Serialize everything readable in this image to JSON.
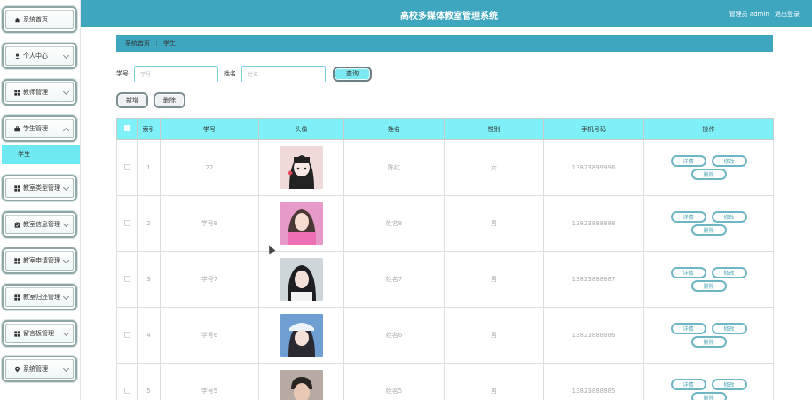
{
  "header": {
    "title": "高校多媒体教室管理系统",
    "user_label": "管理员 admin",
    "logout": "退出登录"
  },
  "sidebar": {
    "items": [
      {
        "label": "系统首页",
        "icon": "home-icon"
      },
      {
        "label": "个人中心",
        "icon": "user-icon"
      },
      {
        "label": "教师管理",
        "icon": "grid-icon"
      },
      {
        "label": "学生管理",
        "icon": "briefcase-icon"
      },
      {
        "label": "教室类型管理",
        "icon": "grid-icon"
      },
      {
        "label": "教室信息管理",
        "icon": "clipboard-icon"
      },
      {
        "label": "教室申请管理",
        "icon": "grid-icon"
      },
      {
        "label": "教室归还管理",
        "icon": "grid-icon"
      },
      {
        "label": "留言板管理",
        "icon": "grid-icon"
      },
      {
        "label": "系统管理",
        "icon": "location-icon"
      }
    ],
    "active_sub": "学生"
  },
  "breadcrumb": {
    "home": "系统首页",
    "sep": "⋮",
    "current": "学生"
  },
  "search": {
    "label_id": "学号",
    "placeholder_id": "学号",
    "label_name": "姓名",
    "placeholder_name": "姓名",
    "query_btn": "查询"
  },
  "actions": {
    "add": "新增",
    "delete": "删除"
  },
  "table": {
    "headers": [
      "",
      "索引",
      "学号",
      "头像",
      "姓名",
      "性别",
      "手机号码",
      "操作"
    ],
    "op_labels": {
      "detail": "详情",
      "edit": "修改",
      "delete": "删除"
    },
    "rows": [
      {
        "index": "1",
        "id": "22",
        "name": "陈红",
        "gender": "女",
        "phone": "13823899996"
      },
      {
        "index": "2",
        "id": "学号8",
        "name": "姓名8",
        "gender": "男",
        "phone": "13823888888"
      },
      {
        "index": "3",
        "id": "学号7",
        "name": "姓名7",
        "gender": "男",
        "phone": "13823888887"
      },
      {
        "index": "4",
        "id": "学号6",
        "name": "姓名6",
        "gender": "男",
        "phone": "13823888886"
      },
      {
        "index": "5",
        "id": "学号5",
        "name": "姓名5",
        "gender": "男",
        "phone": "13823888885"
      }
    ]
  },
  "colors": {
    "header_bg": "#3ea6be",
    "table_head_bg": "#7ff0f8",
    "active_sub_bg": "#6ee8f1"
  }
}
